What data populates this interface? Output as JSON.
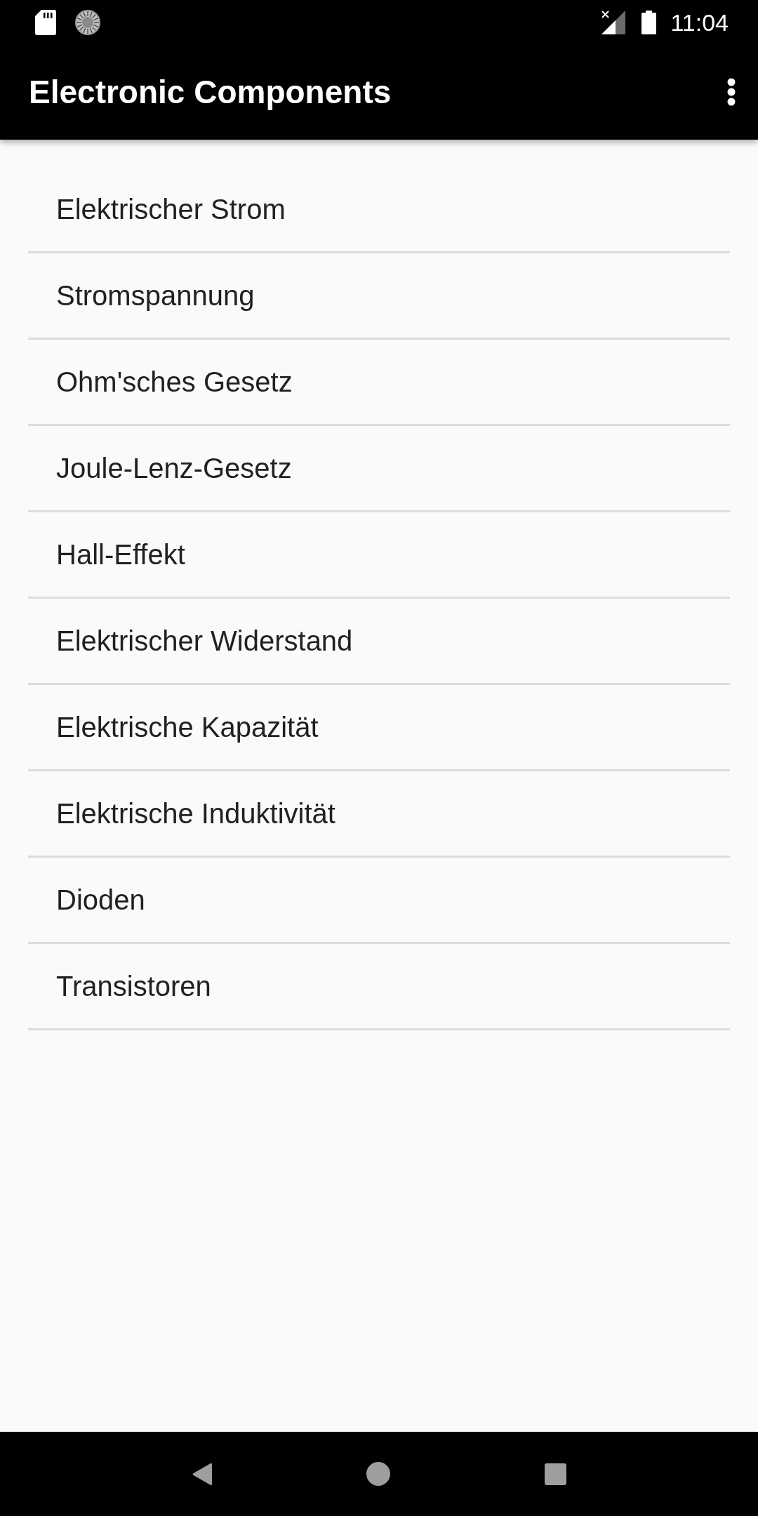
{
  "status_bar": {
    "time": "11:04"
  },
  "app_bar": {
    "title": "Electronic Components"
  },
  "list": {
    "items": [
      {
        "label": "Elektrischer Strom"
      },
      {
        "label": "Stromspannung"
      },
      {
        "label": "Ohm'sches Gesetz"
      },
      {
        "label": "Joule-Lenz-Gesetz"
      },
      {
        "label": "Hall-Effekt"
      },
      {
        "label": "Elektrischer Widerstand"
      },
      {
        "label": "Elektrische Kapazität"
      },
      {
        "label": "Elektrische Induktivität"
      },
      {
        "label": "Dioden"
      },
      {
        "label": "Transistoren"
      }
    ]
  }
}
